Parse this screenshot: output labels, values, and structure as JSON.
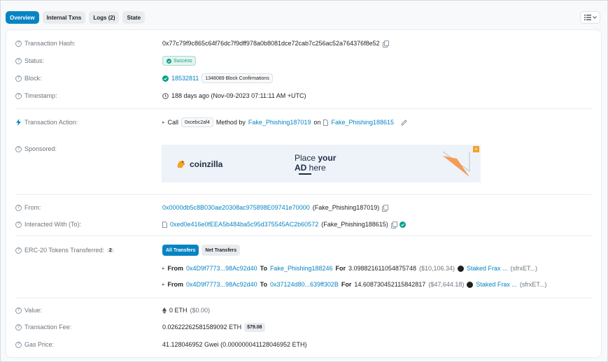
{
  "tabs": [
    {
      "label": "Overview"
    },
    {
      "label": "Internal Txns"
    },
    {
      "label": "Logs (2)"
    },
    {
      "label": "State"
    }
  ],
  "fields": {
    "tx_hash": {
      "label": "Transaction Hash:",
      "value": "0x77c79f9c865c64f76dc7f9dff978a0b8081dce72cab7c256ac52a764376f8e52"
    },
    "status": {
      "label": "Status:",
      "value": "Success"
    },
    "block": {
      "label": "Block:",
      "value": "18532811",
      "confirmations": "1348089 Block Confirmations"
    },
    "timestamp": {
      "label": "Timestamp:",
      "value": "188 days ago (Nov-09-2023 07:11:11 AM +UTC)"
    },
    "action": {
      "label": "Transaction Action:",
      "prefix": "Call",
      "method_id": "0xcebc2af4",
      "method_text": "Method by",
      "by": "Fake_Phishing187019",
      "on_text": "on",
      "contract": "Fake_Phishing188615"
    },
    "sponsored": {
      "label": "Sponsored:"
    },
    "from": {
      "label": "From:",
      "address": "0x0000db5c8B030ae20308ac975898E09741e70000",
      "name": "(Fake_Phishing187019)"
    },
    "to": {
      "label": "Interacted With (To):",
      "address": "0xed0e416e0fEEA5b484ba5c95d375545AC2b60572",
      "name": "(Fake_Phishing188615)"
    },
    "erc20": {
      "label": "ERC-20 Tokens Transferred:",
      "count": "2",
      "tab_all": "All Transfers",
      "tab_net": "Net Transfers",
      "transfers": [
        {
          "from_label": "From",
          "from": "0x4D9f7773...98Ac92d40",
          "to_label": "To",
          "to": "Fake_Phishing188246",
          "for_label": "For",
          "amount": "3.098821611054875748",
          "usd": "($10,106.34)",
          "token": "Staked Frax ...",
          "symbol": "(sfrxET...)"
        },
        {
          "from_label": "From",
          "from": "0x4D9f7773...98Ac92d40",
          "to_label": "To",
          "to": "0x37124d80...639ff302B",
          "for_label": "For",
          "amount": "14.608730452115842817",
          "usd": "($47,644.18)",
          "token": "Staked Frax ...",
          "symbol": "(sfrxET...)"
        }
      ]
    },
    "value": {
      "label": "Value:",
      "value": "0 ETH",
      "usd": "($0.00)"
    },
    "fee": {
      "label": "Transaction Fee:",
      "value": "0.02622262581589092 ETH",
      "usd": "$79.08"
    },
    "gas": {
      "label": "Gas Price:",
      "value": "41.128046952 Gwei (0.000000041128046952 ETH)"
    }
  },
  "ad": {
    "brand": "coinzilla",
    "line1_a": "Place ",
    "line1_b": "your",
    "line2_a": "AD",
    "line2_b": " here",
    "close": "x"
  },
  "colors": {
    "accent": "#0784c3",
    "success": "#00a186"
  }
}
